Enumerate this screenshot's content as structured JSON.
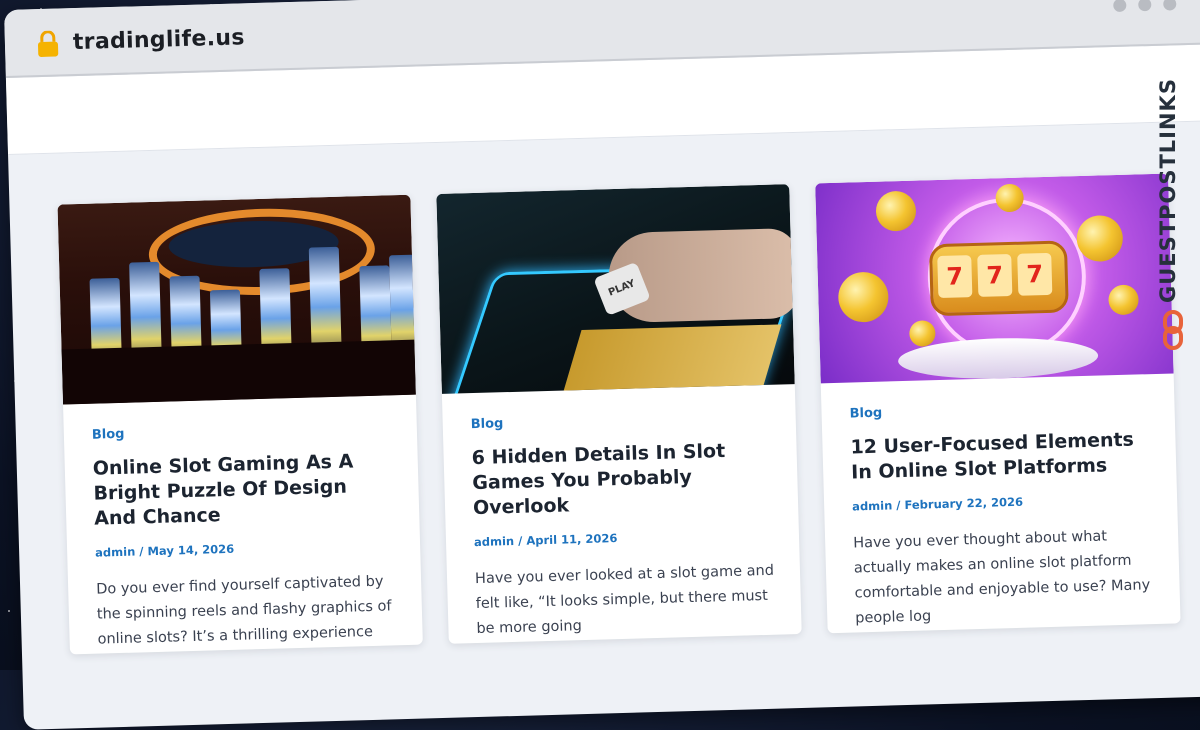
{
  "browser": {
    "url": "tradinglife.us"
  },
  "watermark": "GUESTPOSTLINKS",
  "posts": [
    {
      "category": "Blog",
      "title": "Online Slot Gaming As A Bright Puzzle Of Design And Chance",
      "author": "admin",
      "date": "May 14, 2026",
      "excerpt": "Do you ever find yourself captivated by the spinning reels and flashy graphics of online slots? It’s a thrilling experience […]"
    },
    {
      "category": "Blog",
      "title": "6 Hidden Details In Slot Games You Probably Overlook",
      "author": "admin",
      "date": "April 11, 2026",
      "excerpt": "Have you ever looked at a slot game and felt like, “It looks simple, but there must be more going"
    },
    {
      "category": "Blog",
      "title": "12 User-Focused Elements In Online Slot Platforms",
      "author": "admin",
      "date": "February 22, 2026",
      "excerpt": "Have you ever thought about what actually makes an online slot platform comfortable and enjoyable to use?  Many people log"
    }
  ],
  "colors": {
    "accent": "#1e73be",
    "watermark_icon": "#e8633a"
  }
}
